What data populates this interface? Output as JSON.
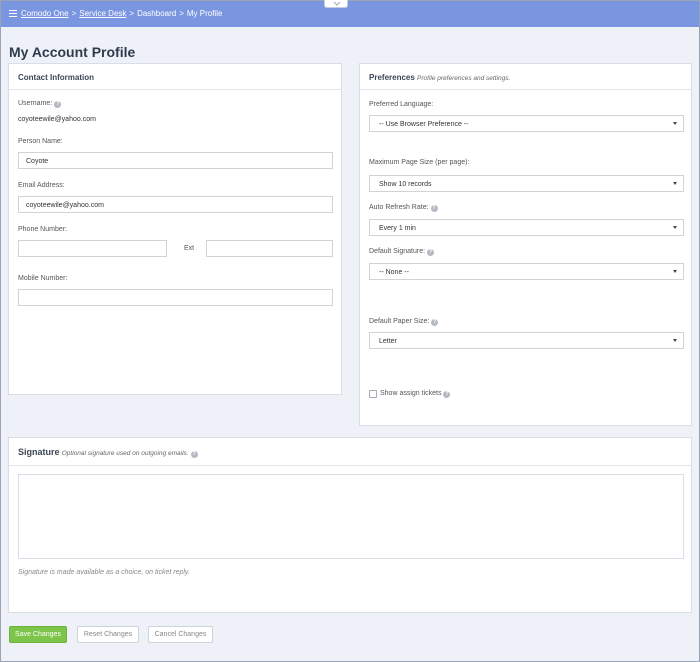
{
  "breadcrumb": {
    "items": [
      "Comodo One",
      "Service Desk",
      "Dashboard",
      "My Profile"
    ],
    "separator": ">"
  },
  "page": {
    "title": "My Account Profile"
  },
  "contact": {
    "heading": "Contact Information",
    "username_label": "Username:",
    "username_value": "coyoteewile@yahoo.com",
    "person_name_label": "Person Name:",
    "person_name_value": "Coyote",
    "email_label": "Email Address:",
    "email_value": "coyoteewile@yahoo.com",
    "phone_label": "Phone Number:",
    "phone_value": "",
    "ext_label": "Ext",
    "ext_value": "",
    "mobile_label": "Mobile Number:",
    "mobile_value": ""
  },
  "preferences": {
    "heading": "Preferences",
    "subheading": "Profile preferences and settings.",
    "language_label": "Preferred Language:",
    "language_value": "-- Use Browser Preference --",
    "page_size_label": "Maximum Page Size (per page):",
    "page_size_value": "Show 10 records",
    "refresh_label": "Auto Refresh Rate:",
    "refresh_value": "Every 1 min",
    "signature_label": "Default Signature:",
    "signature_value": "-- None --",
    "paper_label": "Default Paper Size:",
    "paper_value": "Letter",
    "assign_label": "Show assign tickets",
    "assign_checked": false
  },
  "signature": {
    "heading": "Signature",
    "subheading": "Optional signature used on outgoing emails.",
    "value": "",
    "hint": "Signature is made available as a choice, on ticket reply."
  },
  "actions": {
    "save": "Save Changes",
    "reset": "Reset Changes",
    "cancel": "Cancel Changes"
  },
  "colors": {
    "topbar": "#7b96e0",
    "save_button": "#7cc44a",
    "background": "#eef2f8"
  },
  "icons": {
    "menu": "hamburger-icon",
    "help": "question-circle-icon",
    "toggle": "chevron-down-icon",
    "select": "caret-down-icon"
  }
}
